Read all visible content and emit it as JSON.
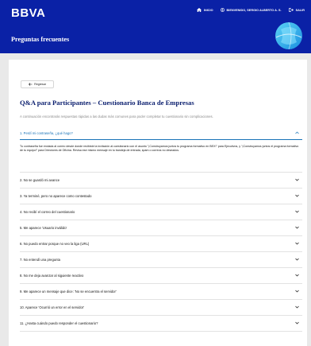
{
  "header": {
    "logo": "BBVA",
    "nav": {
      "home": "INICIO",
      "user": "BIENVENIDO, SERGIO ALBERTO A. S.",
      "logout": "SALIR"
    },
    "section_title": "Preguntas frecuentes"
  },
  "content": {
    "back_label": "Regresar",
    "title": "Q&A para Participantes – Cuestionario Banca de Empresas",
    "intro": "A continuación encontrarás respuestas rápidas a las dudas más comunes para poder completar tu cuestionario sin complicaciones."
  },
  "faq": {
    "items": [
      {
        "question": "1. Perdí mi contraseña, ¿qué hago?",
        "answer": "Tu contraseña fue enviada al correo desde donde recibiste la invitación al cuestionario con el asunto \"¡Construyamos juntos tu programa formativo en BEX!\" para Ejecutivos, y \"¡Construyamos juntos el programa formativo de tu equipo!\" para Directores de Oficina. Revisa ese mismo mensaje en tu bandeja de entrada, spam o correos no deseados."
      },
      {
        "question": "2. No se guardó mi avance"
      },
      {
        "question": "3. Ya terminé, pero no aparece como contestado"
      },
      {
        "question": "4. No recibí el correo del cuestionario"
      },
      {
        "question": "5. Me aparece 'Usuario inválido'"
      },
      {
        "question": "6. No puedo entrar porque no veo la liga (URL)"
      },
      {
        "question": "7. No entendí una pregunta"
      },
      {
        "question": "8. No me deja avanzar al siguiente reactivo"
      },
      {
        "question": "9. Me aparece un mensaje que dice: 'No se encuentra el servidor'"
      },
      {
        "question": "10. Aparece 'Ocurrió un error en el servidor'"
      },
      {
        "question": "11. ¿Hasta cuándo puedo responder el cuestionario?"
      }
    ]
  },
  "colors": {
    "header_bg": "#0a21a6",
    "title": "#0a1e6e",
    "accent": "#1973b8",
    "page_bg": "#e9e9e9"
  },
  "icons": {
    "home": "home-icon",
    "user": "user-icon",
    "logout": "logout-icon",
    "back": "arrow-left-icon",
    "expand": "chevron-down-icon",
    "collapse": "chevron-up-icon",
    "decor": "globe-icon"
  }
}
